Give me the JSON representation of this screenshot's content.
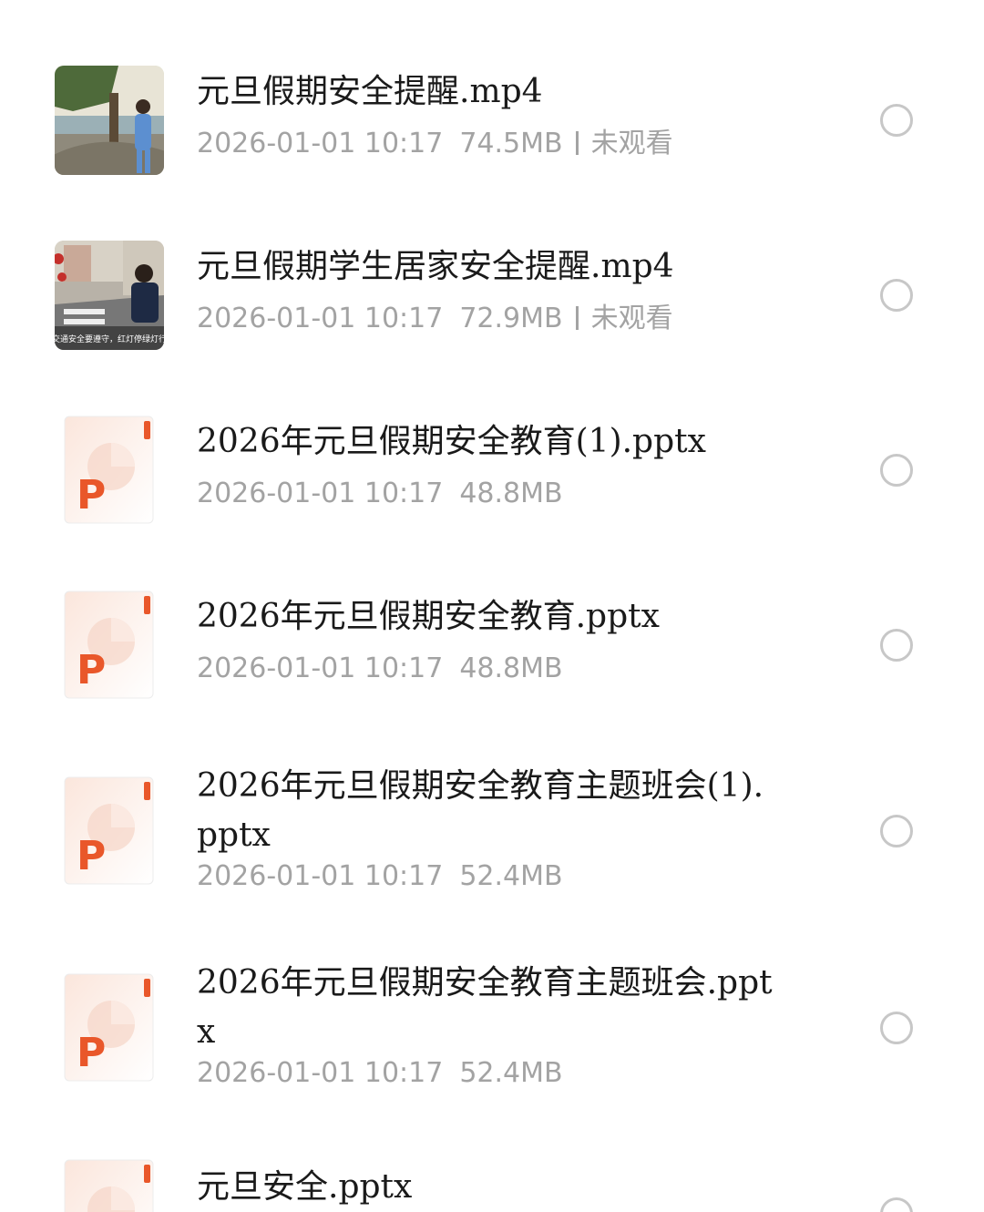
{
  "files": [
    {
      "type": "video",
      "icon": "video-thumbnail",
      "name": "元旦假期安全提醒.mp4",
      "date": "2026-01-01 10:17",
      "size": "74.5MB",
      "status": "未观看"
    },
    {
      "type": "video",
      "icon": "video-thumbnail",
      "name": "元旦假期学生居家安全提醒.mp4",
      "date": "2026-01-01 10:17",
      "size": "72.9MB",
      "status": "未观看",
      "thumb_caption": "交通安全要遵守，红灯停绿灯行"
    },
    {
      "type": "pptx",
      "icon": "ppt-file-icon",
      "name": "2026年元旦假期安全教育(1).pptx",
      "date": "2026-01-01 10:17",
      "size": "48.8MB"
    },
    {
      "type": "pptx",
      "icon": "ppt-file-icon",
      "name": "2026年元旦假期安全教育.pptx",
      "date": "2026-01-01 10:17",
      "size": "48.8MB"
    },
    {
      "type": "pptx",
      "icon": "ppt-file-icon",
      "name": "2026年元旦假期安全教育主题班会(1).pptx",
      "date": "2026-01-01 10:17",
      "size": "52.4MB"
    },
    {
      "type": "pptx",
      "icon": "ppt-file-icon",
      "name": "2026年元旦假期安全教育主题班会.pptx",
      "date": "2026-01-01 10:17",
      "size": "52.4MB"
    },
    {
      "type": "pptx",
      "icon": "ppt-file-icon",
      "name": "元旦安全.pptx"
    }
  ],
  "ppt_letter": "P",
  "colors": {
    "ppt_orange": "#e9572a",
    "meta_gray": "#a3a3a3",
    "radio_border": "#c7c7c7"
  }
}
